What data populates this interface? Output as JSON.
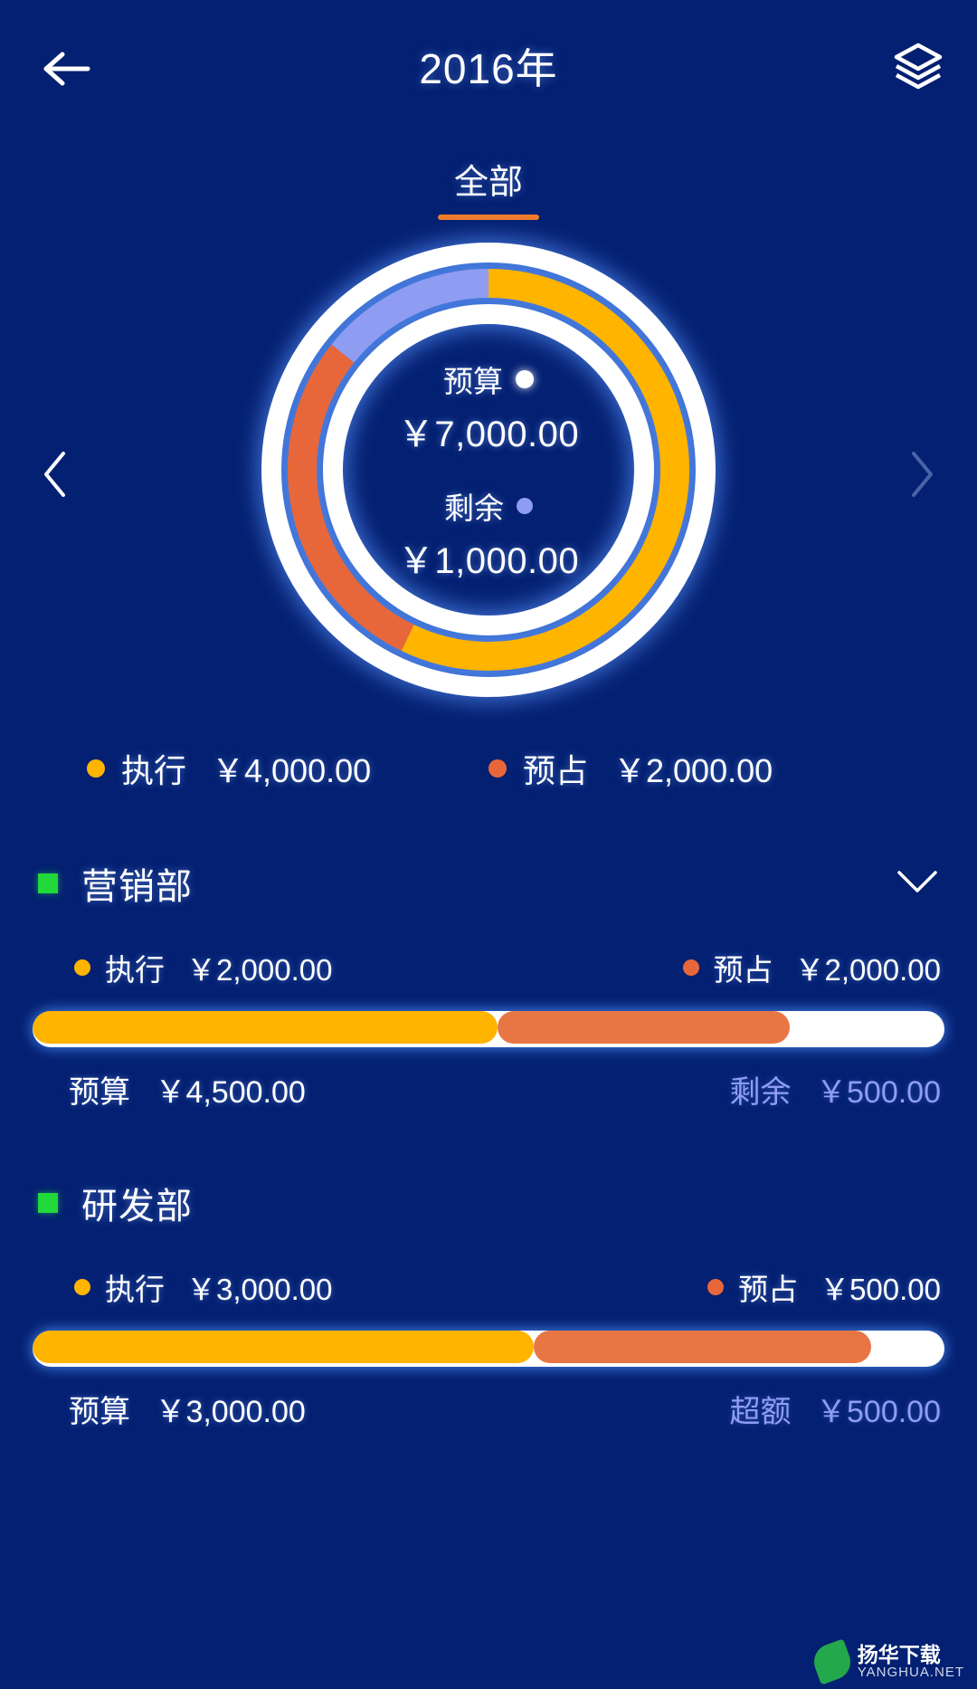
{
  "header": {
    "title": "2016年",
    "back_icon": "arrow-left-icon",
    "layers_icon": "layers-stack-icon"
  },
  "tabs": [
    {
      "label": "全部",
      "active": true
    }
  ],
  "carousel": {
    "prev_icon": "chevron-left-icon",
    "next_icon": "chevron-right-icon"
  },
  "donut": {
    "budget_label": "预算",
    "budget_amount": "￥7,000.00",
    "budget_dot_color": "#ffffff",
    "remaining_label": "剩余",
    "remaining_amount": "￥1,000.00",
    "remaining_dot_color": "#8e9df2"
  },
  "main_legend": [
    {
      "label": "执行",
      "amount": "￥4,000.00",
      "color": "#ffb400"
    },
    {
      "label": "预占",
      "amount": "￥2,000.00",
      "color": "#e8673a"
    }
  ],
  "departments": [
    {
      "name": "营销部",
      "marker_color": "#21d93a",
      "collapse_icon": "chevron-down-icon",
      "exec_label": "执行",
      "exec_amount": "￥2,000.00",
      "exec_color": "#ffb400",
      "pre_label": "预占",
      "pre_amount": "￥2,000.00",
      "pre_color": "#e8673a",
      "budget_label": "预算",
      "budget_amount": "￥4,500.00",
      "status_label": "剩余",
      "status_amount": "￥500.00",
      "exec_pct": 44.4,
      "pre_pct": 44.4
    },
    {
      "name": "研发部",
      "marker_color": "#21d93a",
      "collapse_icon": "chevron-down-icon",
      "exec_label": "执行",
      "exec_amount": "￥3,000.00",
      "exec_color": "#ffb400",
      "pre_label": "预占",
      "pre_amount": "￥500.00",
      "pre_color": "#e8673a",
      "budget_label": "预算",
      "budget_amount": "￥3,000.00",
      "status_label": "超额",
      "status_amount": "￥500.00",
      "exec_pct": 55.0,
      "pre_pct": 37.0
    }
  ],
  "watermark": {
    "main": "扬华下载",
    "sub": "YANGHUA.NET"
  },
  "chart_data": {
    "type": "pie",
    "title": "2016年 全部 预算执行情况",
    "categories": [
      "执行",
      "预占",
      "剩余"
    ],
    "values": [
      4000,
      2000,
      1000
    ],
    "colors": [
      "#ffb400",
      "#e8673a",
      "#8e9df2"
    ],
    "total": 7000,
    "unit": "￥",
    "legend_position": "bottom"
  },
  "theme": {
    "background": "#042072",
    "accent_amber": "#ffb400",
    "accent_orange": "#e8673a",
    "accent_periwinkle": "#8e9df2",
    "accent_green": "#21d93a",
    "tab_underline": "#f07c2b"
  }
}
